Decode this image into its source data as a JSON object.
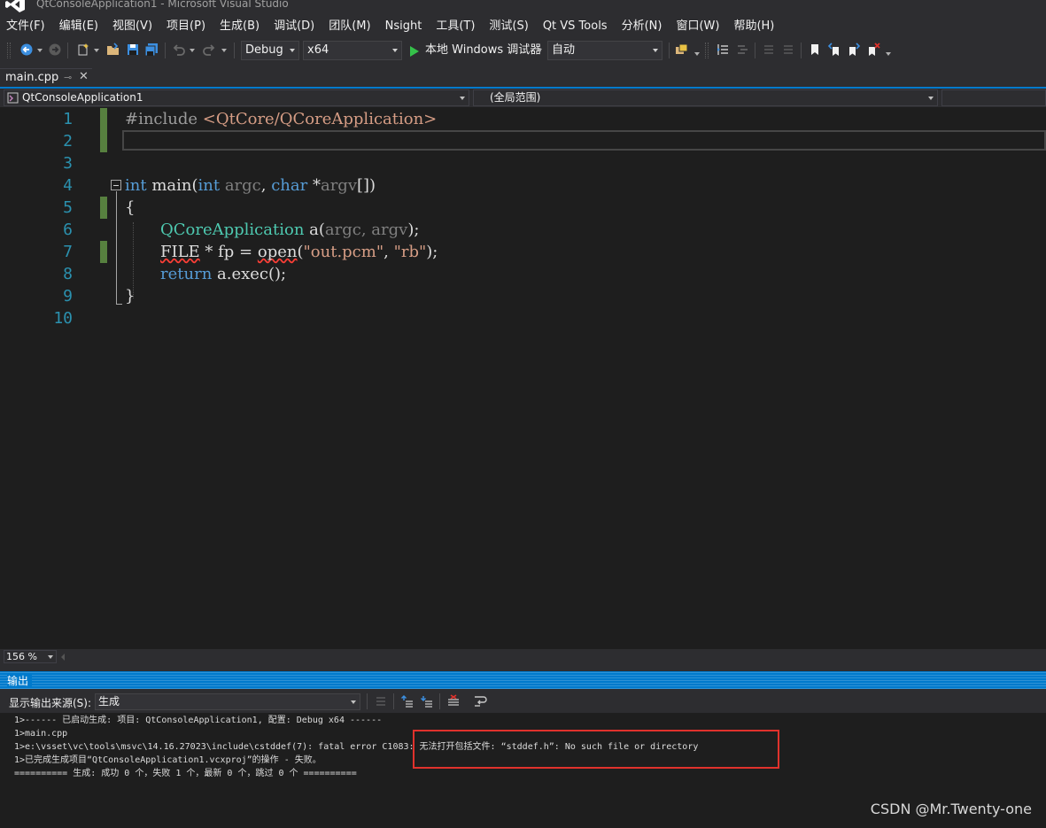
{
  "window": {
    "title": "QtConsoleApplication1 - Microsoft Visual Studio"
  },
  "menu": [
    "文件(F)",
    "编辑(E)",
    "视图(V)",
    "项目(P)",
    "生成(B)",
    "调试(D)",
    "团队(M)",
    "Nsight",
    "工具(T)",
    "测试(S)",
    "Qt VS Tools",
    "分析(N)",
    "窗口(W)",
    "帮助(H)"
  ],
  "toolbar": {
    "config": "Debug",
    "platform": "x64",
    "run_label": "本地 Windows 调试器",
    "run_mode": "自动"
  },
  "tabs": [
    {
      "label": "main.cpp"
    }
  ],
  "navbar": {
    "project": "QtConsoleApplication1",
    "scope": "(全局范围)"
  },
  "editor": {
    "line_numbers": [
      "1",
      "2",
      "3",
      "4",
      "5",
      "6",
      "7",
      "8",
      "9",
      "10"
    ],
    "lines": {
      "l1_directive": "#include ",
      "l1_header": "<QtCore/QCoreApplication>",
      "l4_int": "int",
      "l4_main": " main(",
      "l4_int2": "int",
      "l4_argc": " argc",
      "l4_comma": ", ",
      "l4_char": "char",
      "l4_star": " *",
      "l4_argv": "argv",
      "l4_close": "[])",
      "l5": "{",
      "l6_type": "QCoreApplication",
      "l6_rest": " a(",
      "l6_args": "argc, argv",
      "l6_end": ");",
      "l7_file": "FILE",
      "l7_mid": " * fp = ",
      "l7_open": "open",
      "l7_paren": "(",
      "l7_s1": "\"out.pcm\"",
      "l7_comma": ", ",
      "l7_s2": "\"rb\"",
      "l7_end": ");",
      "l8_return": "return",
      "l8_rest": " a.exec();",
      "l9": "}"
    }
  },
  "zoom": "156 %",
  "output": {
    "title": "输出",
    "source_label": "显示输出来源(S):",
    "source_value": "生成",
    "lines": [
      "1>------ 已启动生成: 项目: QtConsoleApplication1, 配置: Debug x64 ------",
      "1>main.cpp",
      "1>e:\\vsset\\vc\\tools\\msvc\\14.16.27023\\include\\cstddef(7): fatal error C1083: 无法打开包括文件: “stddef.h”: No such file or directory",
      "1>已完成生成项目“QtConsoleApplication1.vcxproj”的操作 - 失败。",
      "========== 生成: 成功 0 个，失败 1 个，最新 0 个，跳过 0 个 =========="
    ]
  },
  "watermark": "CSDN @Mr.Twenty-one"
}
